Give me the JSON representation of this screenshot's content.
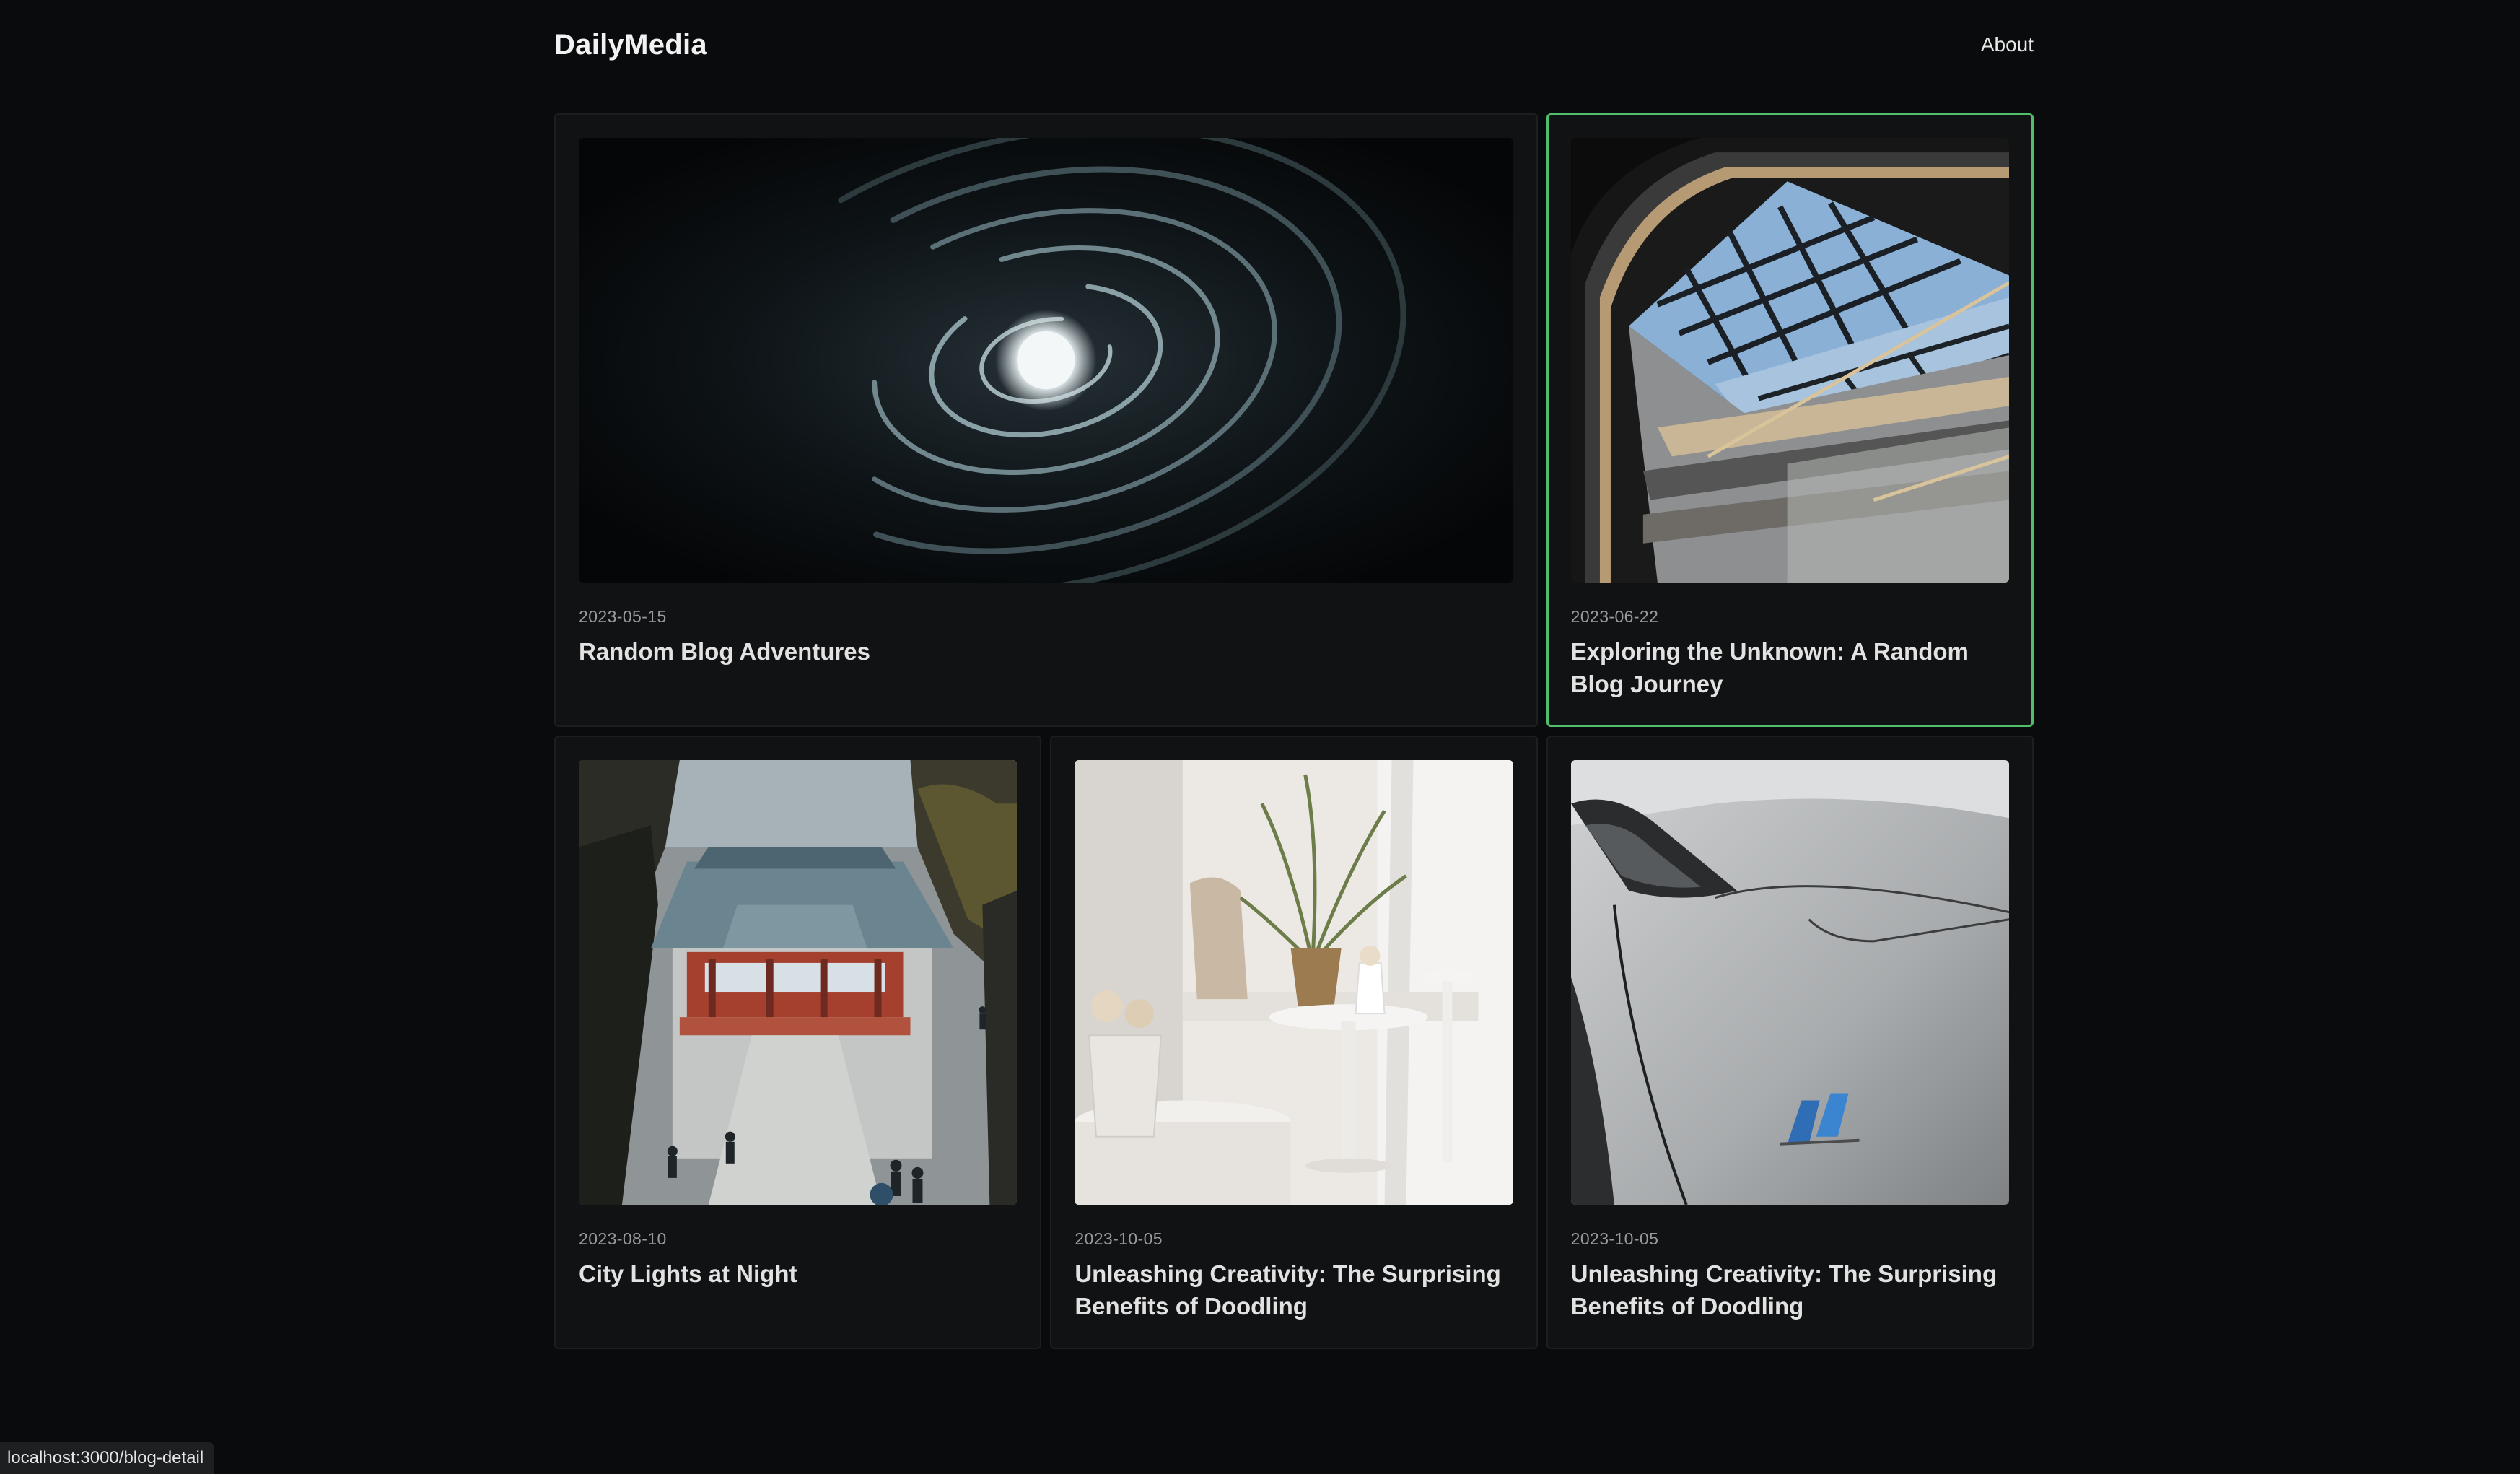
{
  "header": {
    "brand": "DailyMedia",
    "nav_about": "About"
  },
  "posts": [
    {
      "date": "2023-05-15",
      "title": "Random Blog Adventures",
      "image": "spiral-galaxy-image",
      "active": false
    },
    {
      "date": "2023-06-22",
      "title": "Exploring the Unknown: A Random Blog Journey",
      "image": "skylight-architecture-image",
      "active": true
    },
    {
      "date": "2023-08-10",
      "title": "City Lights at Night",
      "image": "temple-scene-image",
      "active": false
    },
    {
      "date": "2023-10-05",
      "title": "Unleashing Creativity: The Surprising Benefits of Doodling",
      "image": "interior-plant-image",
      "active": false
    },
    {
      "date": "2023-10-05",
      "title": "Unleashing Creativity: The Surprising Benefits of Doodling",
      "image": "white-car-image",
      "active": false
    }
  ],
  "status_bar": {
    "url": "localhost:3000/blog-detail"
  },
  "colors": {
    "background": "#0a0b0c",
    "card": "#111213",
    "active_border": "#4fbf6b"
  }
}
